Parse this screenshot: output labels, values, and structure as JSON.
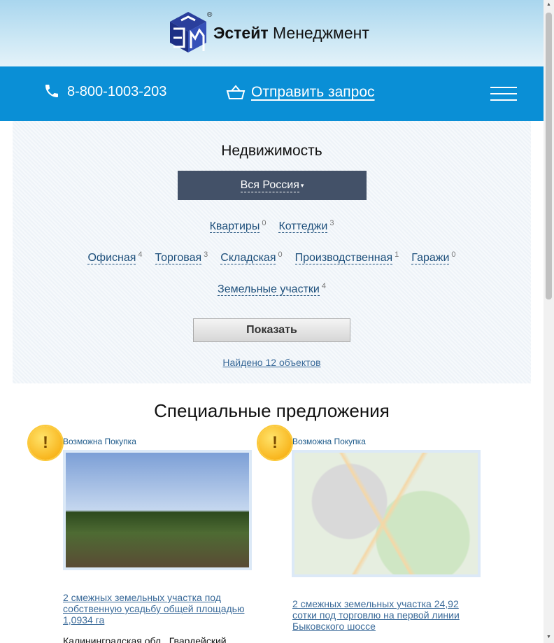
{
  "brand": {
    "name_bold": "Эстейт",
    "name_rest": "Менеджмент",
    "reg": "®"
  },
  "contact": {
    "phone": "8-800-1003-203",
    "request": "Отправить запрос"
  },
  "filter": {
    "title": "Недвижимость",
    "region": "Вся Россия",
    "row1": [
      {
        "label": "Квартиры",
        "count": "0"
      },
      {
        "label": "Коттеджи",
        "count": "3"
      }
    ],
    "row2": [
      {
        "label": "Офисная",
        "count": "4"
      },
      {
        "label": "Торговая",
        "count": "3"
      },
      {
        "label": "Складская",
        "count": "0"
      },
      {
        "label": "Производственная",
        "count": "1"
      },
      {
        "label": "Гаражи",
        "count": "0"
      }
    ],
    "row3": [
      {
        "label": "Земельные участки",
        "count": "4"
      }
    ],
    "show": "Показать",
    "found": "Найдено 12 объектов"
  },
  "special": {
    "title": "Специальные предложения",
    "cards": [
      {
        "tag": "Возможна Покупка",
        "title": "2 смежных земельных участка под собственную усадьбу общей площадью 1,0934 га",
        "address": "Калининградская обл., Гвардейский"
      },
      {
        "tag": "Возможна Покупка",
        "title": "2 смежных земельных участка 24,92 сотки под торговлю на первой линии Быковского шоссе"
      }
    ]
  }
}
